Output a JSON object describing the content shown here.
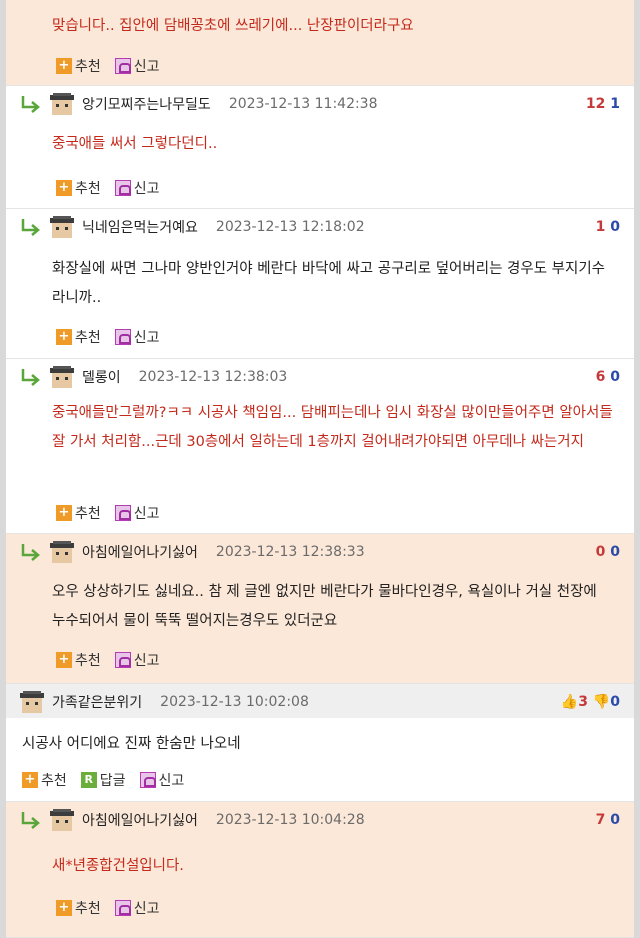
{
  "labels": {
    "recommend": "추천",
    "report": "신고",
    "reply": "답글",
    "plus": "+",
    "r": "R"
  },
  "colors": {
    "highlight_bg": "#fce8d8",
    "vote_up": "#c43a3a",
    "vote_down": "#2b4ba8",
    "body_red": "#c42a1c",
    "recommend_icon": "#f09a28",
    "reply_icon": "#6cae3c"
  },
  "comments": [
    {
      "nick": "",
      "date": "",
      "up": "",
      "down": "",
      "body": "맞습니다.. 집안에 담배꽁초에 쓰레기에... 난장판이더라구요"
    },
    {
      "nick": "앙기모찌주는나무딜도",
      "date": "2023-12-13 11:42:38",
      "up": "12",
      "down": "1",
      "body": "중국애들 써서 그렇다던디.."
    },
    {
      "nick": "닉네임은먹는거예요",
      "date": "2023-12-13 12:18:02",
      "up": "1",
      "down": "0",
      "body": "화장실에 싸면 그나마 양반인거야 베란다 바닥에 싸고 공구리로 덮어버리는 경우도 부지기수라니까.."
    },
    {
      "nick": "델롱이",
      "date": "2023-12-13 12:38:03",
      "up": "6",
      "down": "0",
      "body": "중국애들만그럴까?ㅋㅋ 시공사 책임임... 담배피는데나 임시 화장실 많이만들어주면 알아서들 잘 가서 처리함...근데 30층에서 일하는데 1층까지 걸어내려가야되면 아무데나 싸는거지"
    },
    {
      "nick": "아침에일어나기싫어",
      "date": "2023-12-13 12:38:33",
      "up": "0",
      "down": "0",
      "body": "오우 상상하기도 싫네요.. 참 제 글엔 없지만 베란다가 물바다인경우, 욕실이나 거실 천장에 누수되어서 물이 뚝뚝 떨어지는경우도 있더군요"
    },
    {
      "nick": "가족같은분위기",
      "date": "2023-12-13 10:02:08",
      "up": "3",
      "down": "0",
      "body": "시공사 어디에요 진짜 한숨만 나오네"
    },
    {
      "nick": "아침에일어나기싫어",
      "date": "2023-12-13 10:04:28",
      "up": "7",
      "down": "0",
      "body": "새*년종합건설입니다."
    }
  ]
}
